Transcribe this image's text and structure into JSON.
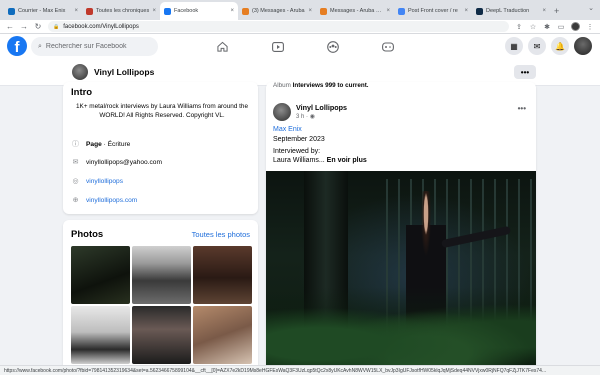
{
  "browser": {
    "tabs": [
      {
        "title": "Courrier - Max Enix",
        "active": false,
        "color": "#0f6cbd"
      },
      {
        "title": "Toutes les chroniques",
        "active": false,
        "color": "#c0392b"
      },
      {
        "title": "Facebook",
        "active": true,
        "color": "#1877f2"
      },
      {
        "title": "(3) Messages - Aruba",
        "active": false,
        "color": "#e67e22"
      },
      {
        "title": "Messages - Aruba Webmail",
        "active": false,
        "color": "#e67e22"
      },
      {
        "title": "Post Front cover / re",
        "active": false,
        "color": "#4285f4"
      },
      {
        "title": "DeepL Traduction",
        "active": false,
        "color": "#0f2b46"
      }
    ],
    "url": "facebook.com/VinylLollipops",
    "status_url": "https://www.facebook.com/photo/?fbid=798141352319634&set=a.562346675899104&__cft__[0]=AZX7e2kD19Ms8eHGFEsWaQ3F3UzLqp5tQc2x8yUKcAvhN8WVW15LX_bvJp3IgUFJsotfHW05klqJqMjSdeq44NVVjxw0RjNFQ7qFZjJTK7Fes74..."
  },
  "facebook": {
    "search_placeholder": "Rechercher sur Facebook",
    "page_name": "Vinyl Lollipops",
    "more_label": "•••"
  },
  "intro": {
    "heading": "Intro",
    "bio": "1K+ metal/rock interviews by Laura Williams from around the WORLD! All Rights Reserved. Copyright VL.",
    "category_bold": "Page",
    "category_rest": " · Écriture",
    "email": "vinyllollipops@yahoo.com",
    "instagram": "vinyllollipops",
    "website": "vinyllollipops.com"
  },
  "photos": {
    "heading": "Photos",
    "see_all": "Toutes les photos"
  },
  "post": {
    "album_prefix": "Album ",
    "album_name": "Interviews 999 to current.",
    "author": "Vinyl Lollipops",
    "meta": "3 h · ",
    "line1": "Max Enix",
    "line2": "September 2023",
    "line3": "Interviewed by:",
    "line4": "Laura Williams...",
    "see_more": " En voir plus",
    "more_label": "•••"
  }
}
